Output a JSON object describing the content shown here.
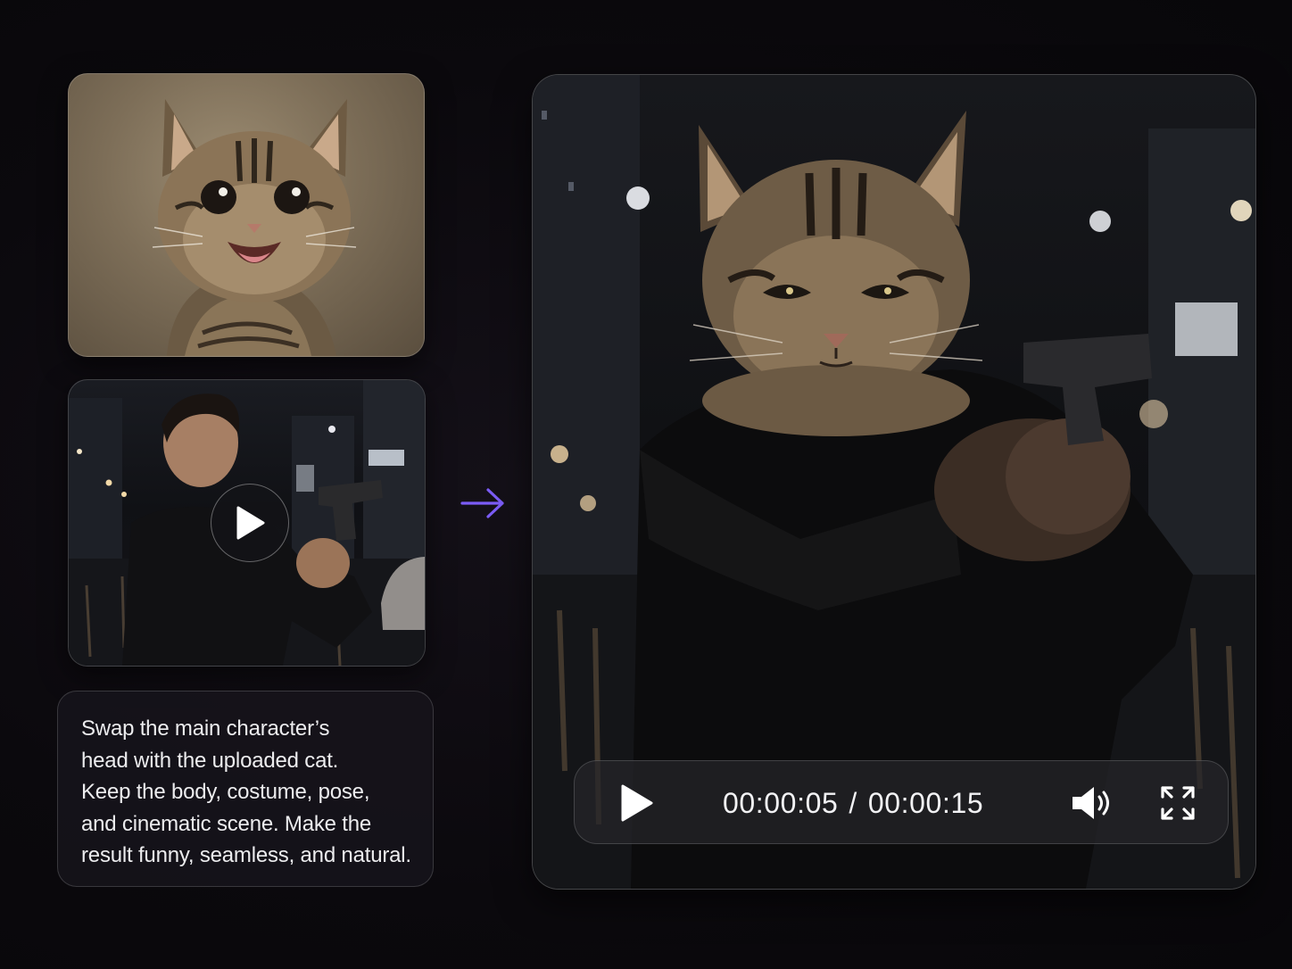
{
  "inputs": {
    "cat_image": {
      "icon": "cat-photo",
      "alt": ""
    },
    "source_video": {
      "icon": "play-icon"
    }
  },
  "prompt": {
    "text": "Swap the main character’s\nhead with the uploaded cat.\nKeep the body, costume, pose,\nand cinematic scene. Make the\nresult funny, seamless, and natural."
  },
  "arrow": {
    "icon": "arrow-right-icon",
    "color": "#7b5cf5"
  },
  "player": {
    "current_time": "00:00:05",
    "separator": "/",
    "total_time": "00:00:15",
    "progress": 0.3333,
    "icons": [
      "play-icon",
      "volume-icon",
      "fullscreen-icon"
    ]
  },
  "colors": {
    "background": "#0b090d",
    "accent": "#7b5cf5",
    "text": "#ececee"
  }
}
